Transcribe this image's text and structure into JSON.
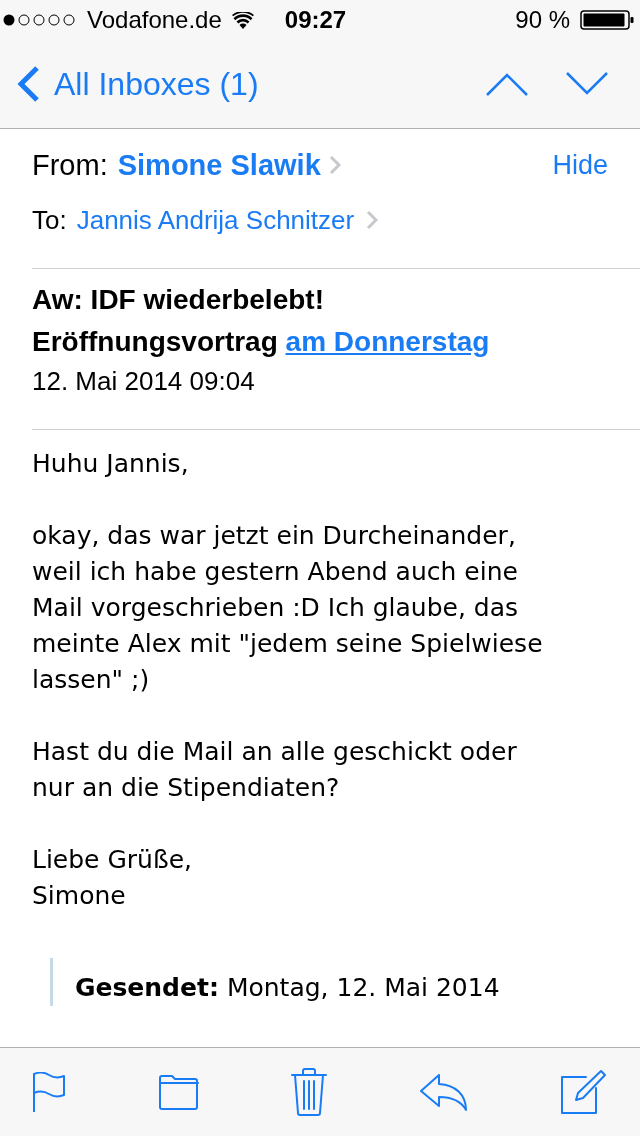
{
  "status_bar": {
    "carrier": "Vodafone.de",
    "time": "09:27",
    "battery": "90 %"
  },
  "nav_bar": {
    "back": "All Inboxes (1)"
  },
  "header": {
    "from_label": "From:",
    "from": "Simone Slawik",
    "hide": "Hide",
    "to_label": "To:",
    "to": "Jannis Andrija Schnitzer"
  },
  "subject": {
    "text": "Aw: IDF wiederbelebt!\nEröffnungsvortrag",
    "link": "am Donnerstag"
  },
  "date": "12. Mai 2014 09:04",
  "body": [
    "Huhu Jannis,",
    "okay, das war jetzt ein Durcheinander,\nweil ich habe gestern Abend auch eine\nMail vorgeschrieben :D Ich glaube, das\nmeinte Alex mit \"jedem seine Spielwiese\nlassen\" ;)",
    "Hast du die Mail an alle geschickt oder\nnur an die Stipendiaten?",
    "Liebe Grüße,\nSimone"
  ],
  "quote": {
    "label": "Gesendet:",
    "text": "Montag, 12. Mai 2014"
  },
  "toolbar": [
    {
      "kind": "flag"
    },
    {
      "kind": "folder"
    },
    {
      "kind": "trash"
    },
    {
      "kind": "reply"
    },
    {
      "kind": "compose"
    }
  ]
}
